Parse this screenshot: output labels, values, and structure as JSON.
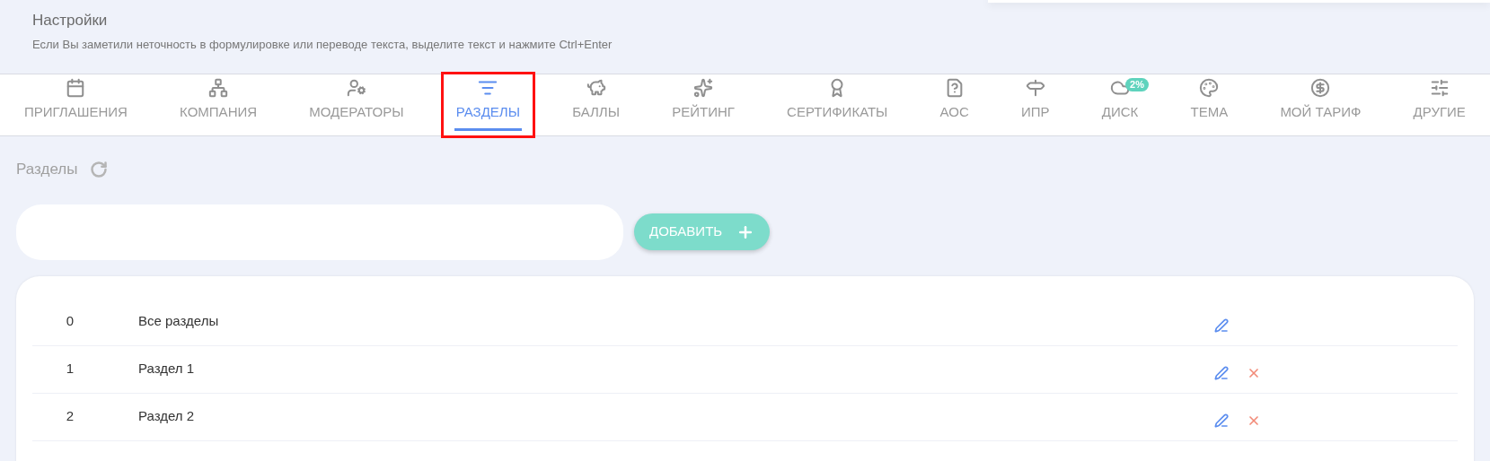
{
  "header": {
    "title": "Настройки",
    "subtitle": "Если Вы заметили неточность в формулировке или переводе текста, выделите текст и нажмите Ctrl+Enter"
  },
  "tabs": [
    {
      "label": "ПРИГЛАШЕНИЯ",
      "selected": false,
      "highlighted": false
    },
    {
      "label": "КОМПАНИЯ",
      "selected": false,
      "highlighted": false
    },
    {
      "label": "МОДЕРАТОРЫ",
      "selected": false,
      "highlighted": false
    },
    {
      "label": "РАЗДЕЛЫ",
      "selected": true,
      "highlighted": true
    },
    {
      "label": "БАЛЛЫ",
      "selected": false,
      "highlighted": false
    },
    {
      "label": "РЕЙТИНГ",
      "selected": false,
      "highlighted": false
    },
    {
      "label": "СЕРТИФИКАТЫ",
      "selected": false,
      "highlighted": false
    },
    {
      "label": "АОС",
      "selected": false,
      "highlighted": false
    },
    {
      "label": "ИПР",
      "selected": false,
      "highlighted": false
    },
    {
      "label": "ДИСК",
      "selected": false,
      "highlighted": false,
      "badge": "2%"
    },
    {
      "label": "ТЕМА",
      "selected": false,
      "highlighted": false
    },
    {
      "label": "МОЙ ТАРИФ",
      "selected": false,
      "highlighted": false
    },
    {
      "label": "ДРУГИЕ",
      "selected": false,
      "highlighted": false
    }
  ],
  "section": {
    "title": "Разделы",
    "add_button": "ДОБАВИТЬ"
  },
  "rows": [
    {
      "number": "0",
      "name": "Все разделы",
      "deletable": false
    },
    {
      "number": "1",
      "name": "Раздел 1",
      "deletable": true
    },
    {
      "number": "2",
      "name": "Раздел 2",
      "deletable": true
    }
  ]
}
